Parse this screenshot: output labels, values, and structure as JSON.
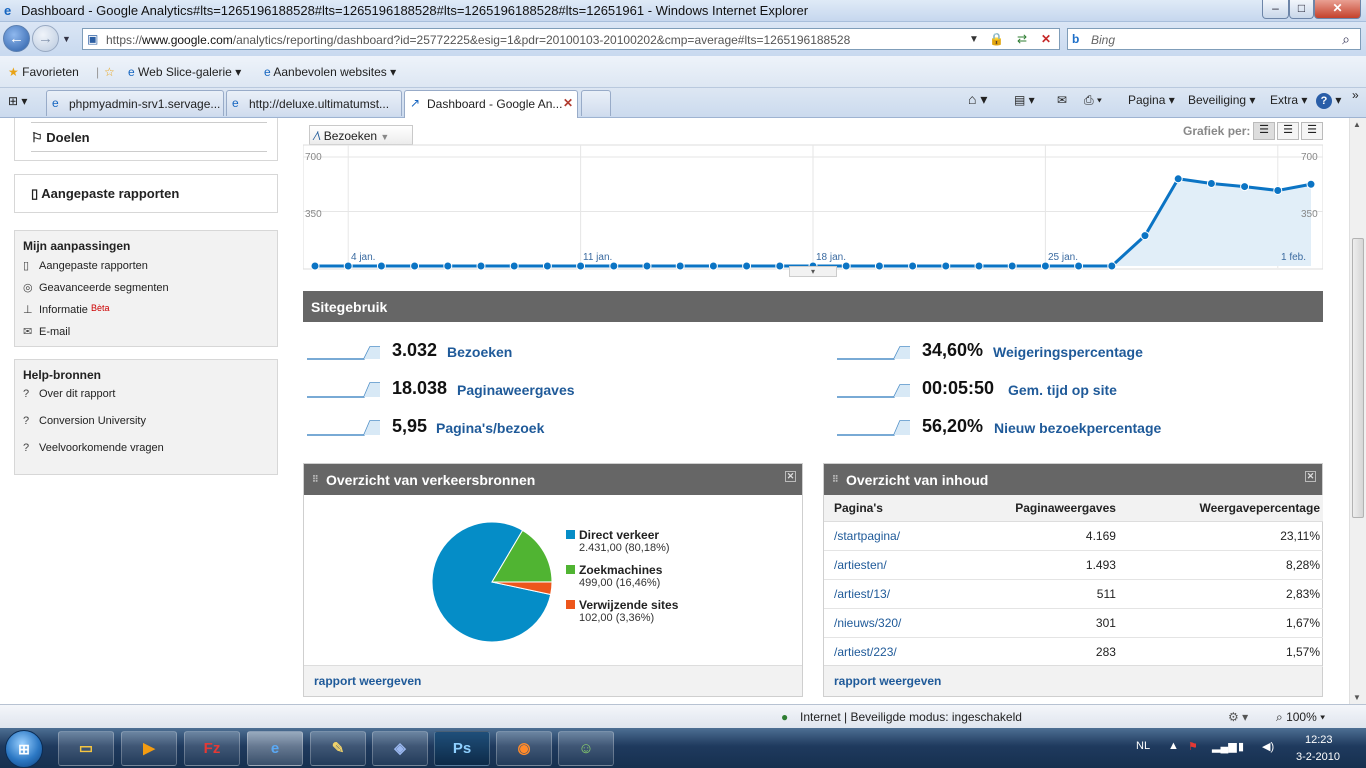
{
  "window": {
    "title": "Dashboard - Google Analytics#lts=1265196188528#lts=1265196188528#lts=1265196188528#lts=12651961 - Windows Internet Explorer",
    "minimize": "–",
    "maximize": "□",
    "close": "✕"
  },
  "address": {
    "url_prefix": "https://",
    "url_domain": "www.google.com",
    "url_rest": "/analytics/reporting/dashboard?id=25772225&esig=1&pdr=20100103-20100202&cmp=average#lts=1265196188528",
    "search_placeholder": "Bing"
  },
  "favorites": {
    "favorites": "Favorieten",
    "web_slice": "Web Slice-galerie",
    "recommended": "Aanbevolen websites"
  },
  "tabs": [
    {
      "label": "phpmyadmin-srv1.servage..."
    },
    {
      "label": "http://deluxe.ultimatumst..."
    },
    {
      "label": "Dashboard - Google An..."
    }
  ],
  "commands": {
    "page": "Pagina",
    "safety": "Beveiliging",
    "tools": "Extra",
    "help": "?"
  },
  "sidebar": {
    "goals": "Doelen",
    "custom_reports": "Aangepaste rapporten",
    "my_custom_title": "Mijn aanpassingen",
    "my_custom_items": [
      {
        "label": "Aangepaste rapporten"
      },
      {
        "label": "Geavanceerde segmenten"
      },
      {
        "label": "Informatie",
        "badge": "Bèta"
      },
      {
        "label": "E-mail"
      }
    ],
    "help_title": "Help-bronnen",
    "help_items": [
      {
        "label": "Over dit rapport"
      },
      {
        "label": "Conversion University"
      },
      {
        "label": "Veelvoorkomende vragen"
      }
    ]
  },
  "graph": {
    "metric_select": "Bezoeken",
    "graph_by": "Grafiek per:",
    "y_ticks": [
      "700",
      "350"
    ],
    "x_labels": [
      "4 jan.",
      "11 jan.",
      "18 jan.",
      "25 jan.",
      "1 feb."
    ]
  },
  "chart_data": {
    "type": "area",
    "title": "",
    "ylim": [
      0,
      700
    ],
    "y_ticks": [
      350,
      700
    ],
    "x_tick_labels": [
      "4 jan.",
      "11 jan.",
      "18 jan.",
      "25 jan.",
      "1 feb."
    ],
    "x": [
      "3 jan.",
      "4 jan.",
      "5 jan.",
      "6 jan.",
      "7 jan.",
      "8 jan.",
      "9 jan.",
      "10 jan.",
      "11 jan.",
      "12 jan.",
      "13 jan.",
      "14 jan.",
      "15 jan.",
      "16 jan.",
      "17 jan.",
      "18 jan.",
      "19 jan.",
      "20 jan.",
      "21 jan.",
      "22 jan.",
      "23 jan.",
      "24 jan.",
      "25 jan.",
      "26 jan.",
      "27 jan.",
      "28 jan.",
      "29 jan.",
      "30 jan.",
      "31 jan.",
      "1 feb.",
      "2 feb."
    ],
    "series": [
      {
        "name": "Bezoeken",
        "values": [
          0,
          0,
          0,
          0,
          0,
          0,
          0,
          0,
          0,
          0,
          0,
          0,
          0,
          0,
          0,
          0,
          0,
          0,
          0,
          0,
          0,
          0,
          0,
          0,
          0,
          195,
          560,
          530,
          510,
          485,
          525
        ]
      }
    ],
    "grid": true
  },
  "site_usage": {
    "title": "Sitegebruik",
    "metrics": [
      {
        "value": "3.032",
        "label": "Bezoeken"
      },
      {
        "value": "18.038",
        "label": "Paginaweergaves"
      },
      {
        "value": "5,95",
        "label": "Pagina's/bezoek"
      },
      {
        "value": "34,60%",
        "label": "Weigeringspercentage"
      },
      {
        "value": "00:05:50",
        "label": "Gem. tijd op site"
      },
      {
        "value": "56,20%",
        "label": "Nieuw bezoekpercentage"
      }
    ]
  },
  "traffic": {
    "title": "Overzicht van verkeersbronnen",
    "footer": "rapport weergeven",
    "sources": [
      {
        "name": "Direct verkeer",
        "detail": "2.431,00 (80,18%)",
        "value": 2431,
        "color": "#058dc7"
      },
      {
        "name": "Zoekmachines",
        "detail": "499,00 (16,46%)",
        "value": 499,
        "color": "#50b432"
      },
      {
        "name": "Verwijzende sites",
        "detail": "102,00 (3,36%)",
        "value": 102,
        "color": "#ed561b"
      }
    ]
  },
  "content": {
    "title": "Overzicht van inhoud",
    "footer": "rapport weergeven",
    "headers": [
      "Pagina's",
      "Paginaweergaves",
      "Weergavepercentage"
    ],
    "rows": [
      {
        "page": "/startpagina/",
        "views": "4.169",
        "pct": "23,11%"
      },
      {
        "page": "/artiesten/",
        "views": "1.493",
        "pct": "8,28%"
      },
      {
        "page": "/artiest/13/",
        "views": "511",
        "pct": "2,83%"
      },
      {
        "page": "/nieuws/320/",
        "views": "301",
        "pct": "1,67%"
      },
      {
        "page": "/artiest/223/",
        "views": "283",
        "pct": "1,57%"
      }
    ]
  },
  "statusbar": {
    "zone": "Internet | Beveiligde modus: ingeschakeld",
    "zoom": "100%"
  },
  "taskbar": {
    "lang": "NL",
    "time": "12:23",
    "date": "3-2-2010"
  }
}
